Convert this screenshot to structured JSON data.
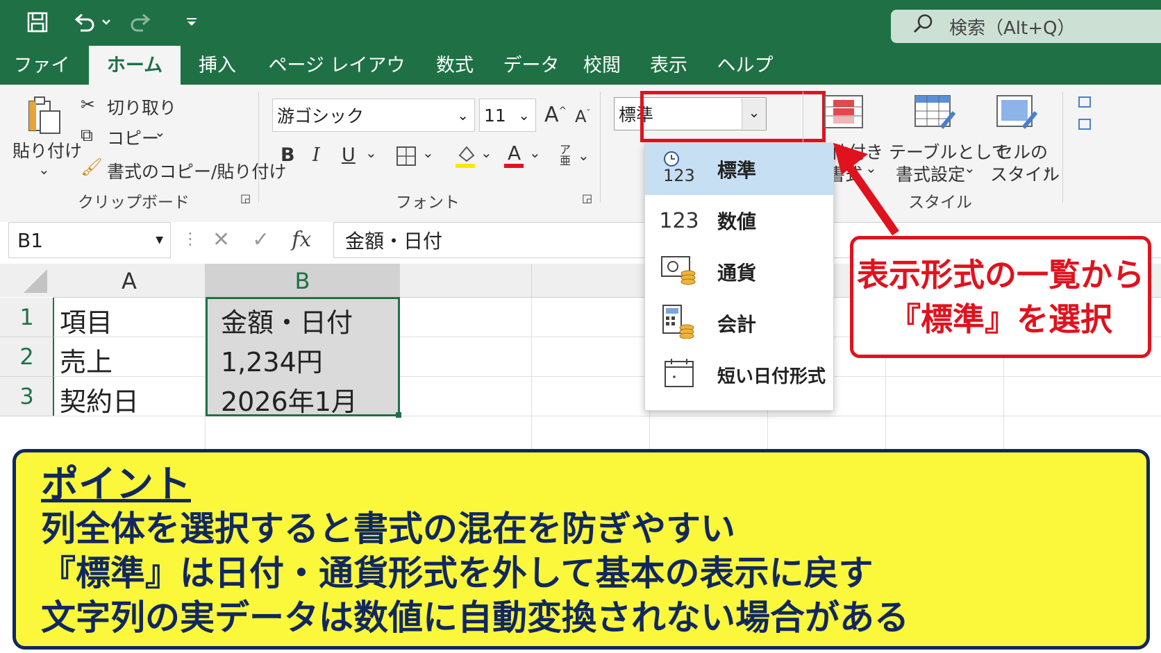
{
  "title_bar": {
    "search_placeholder": "検索（Alt+Q）",
    "icons": [
      "save-icon",
      "undo-icon",
      "redo-icon",
      "customize-qat-icon",
      "search-icon"
    ]
  },
  "tabs": [
    "ファイル",
    "ホーム",
    "挿入",
    "ページ レイアウト",
    "数式",
    "データ",
    "校閲",
    "表示",
    "ヘルプ"
  ],
  "active_tab": "ホーム",
  "ribbon": {
    "clipboard": {
      "paste": "貼り付け",
      "cut": "切り取り",
      "copy": "コピー",
      "format_painter": "書式のコピー/貼り付け",
      "group_label": "クリップボード"
    },
    "font": {
      "font_name": "游ゴシック",
      "font_size": "11",
      "group_label": "フォント"
    },
    "number": {
      "format_value": "標準"
    },
    "styles": {
      "conditional_line1": "条件付き",
      "conditional_line2": "書式",
      "table_line1": "テーブルとして",
      "table_line2": "書式設定",
      "cell_line1": "セルの",
      "cell_line2": "スタイル",
      "group_label": "スタイル"
    }
  },
  "formula_bar": {
    "name_box": "B1",
    "fx": "fx",
    "content": "金額・日付"
  },
  "sheet": {
    "columns": [
      "A",
      "B"
    ],
    "rows": [
      {
        "num": "1",
        "a": "項目",
        "b": "金額・日付"
      },
      {
        "num": "2",
        "a": "売上",
        "b": "1,234円"
      },
      {
        "num": "3",
        "a": "契約日",
        "b": "2026年1月"
      }
    ]
  },
  "dropdown": {
    "items": [
      {
        "icon": "standard-format-icon",
        "glyph": "123",
        "label": "標準"
      },
      {
        "icon": "number-format-icon",
        "glyph": "123",
        "label": "数値"
      },
      {
        "icon": "currency-format-icon",
        "glyph": "",
        "label": "通貨"
      },
      {
        "icon": "accounting-format-icon",
        "glyph": "",
        "label": "会計"
      },
      {
        "icon": "short-date-format-icon",
        "glyph": "",
        "label": "短い日付形式"
      }
    ]
  },
  "callout": {
    "line1": "表示形式の一覧から",
    "line2": "『標準』を選択"
  },
  "point": {
    "title": "ポイント",
    "lines": [
      "列全体を選択すると書式の混在を防ぎやすい",
      "『標準』は日付・通貨形式を外して基本の表示に戻す",
      "文字列の実データは数値に自動変換されない場合がある"
    ]
  },
  "colors": {
    "excel_green": "#1f7145",
    "highlight_red": "#e0121d",
    "point_yellow": "#fbf73a",
    "point_navy": "#11285e"
  }
}
